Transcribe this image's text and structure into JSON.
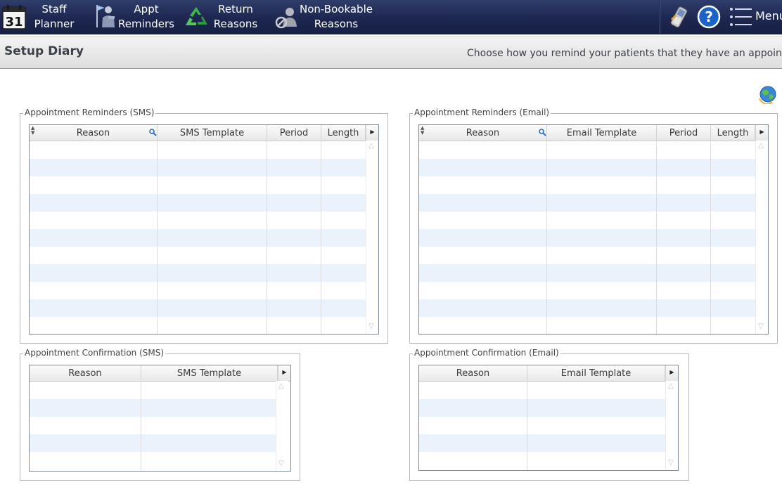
{
  "nav": {
    "items": [
      {
        "line1": "Staff",
        "line2": "Planner",
        "icon": "calendar-icon",
        "calendar_day": "31"
      },
      {
        "line1": "Appt",
        "line2": "Reminders",
        "icon": "flag-person-icon"
      },
      {
        "line1": "Return",
        "line2": "Reasons",
        "icon": "recycle-icon"
      },
      {
        "line1": "Non-Bookable",
        "line2": "Reasons",
        "icon": "person-blocked-icon"
      }
    ],
    "right": {
      "phone_icon": "mobile-phone-icon",
      "help_icon": "help-icon",
      "help_glyph": "?",
      "menu_icon": "hamburger-menu-icon",
      "menu_label": "Menu"
    }
  },
  "page": {
    "title": "Setup Diary",
    "description": "Choose how you remind your patients that they have an appointmer"
  },
  "toolbar": {
    "refresh_icon": "globe-refresh-icon"
  },
  "panels": {
    "sms_reminders": {
      "legend": "Appointment Reminders (SMS)",
      "columns": [
        "Reason",
        "SMS Template",
        "Period",
        "Length"
      ],
      "rows": []
    },
    "email_reminders": {
      "legend": "Appointment Reminders (Email)",
      "columns": [
        "Reason",
        "Email Template",
        "Period",
        "Length"
      ],
      "rows": []
    },
    "sms_confirmation": {
      "legend": "Appointment Confirmation (SMS)",
      "columns": [
        "Reason",
        "SMS Template"
      ],
      "rows": []
    },
    "email_confirmation": {
      "legend": "Appointment Confirmation (Email)",
      "columns": [
        "Reason",
        "Email Template"
      ],
      "rows": []
    }
  },
  "colors": {
    "topbar": "#1d2750",
    "row_alt": "#eaf2fb",
    "grid_border": "#7f8a99",
    "help_blue": "#1a63c9"
  }
}
